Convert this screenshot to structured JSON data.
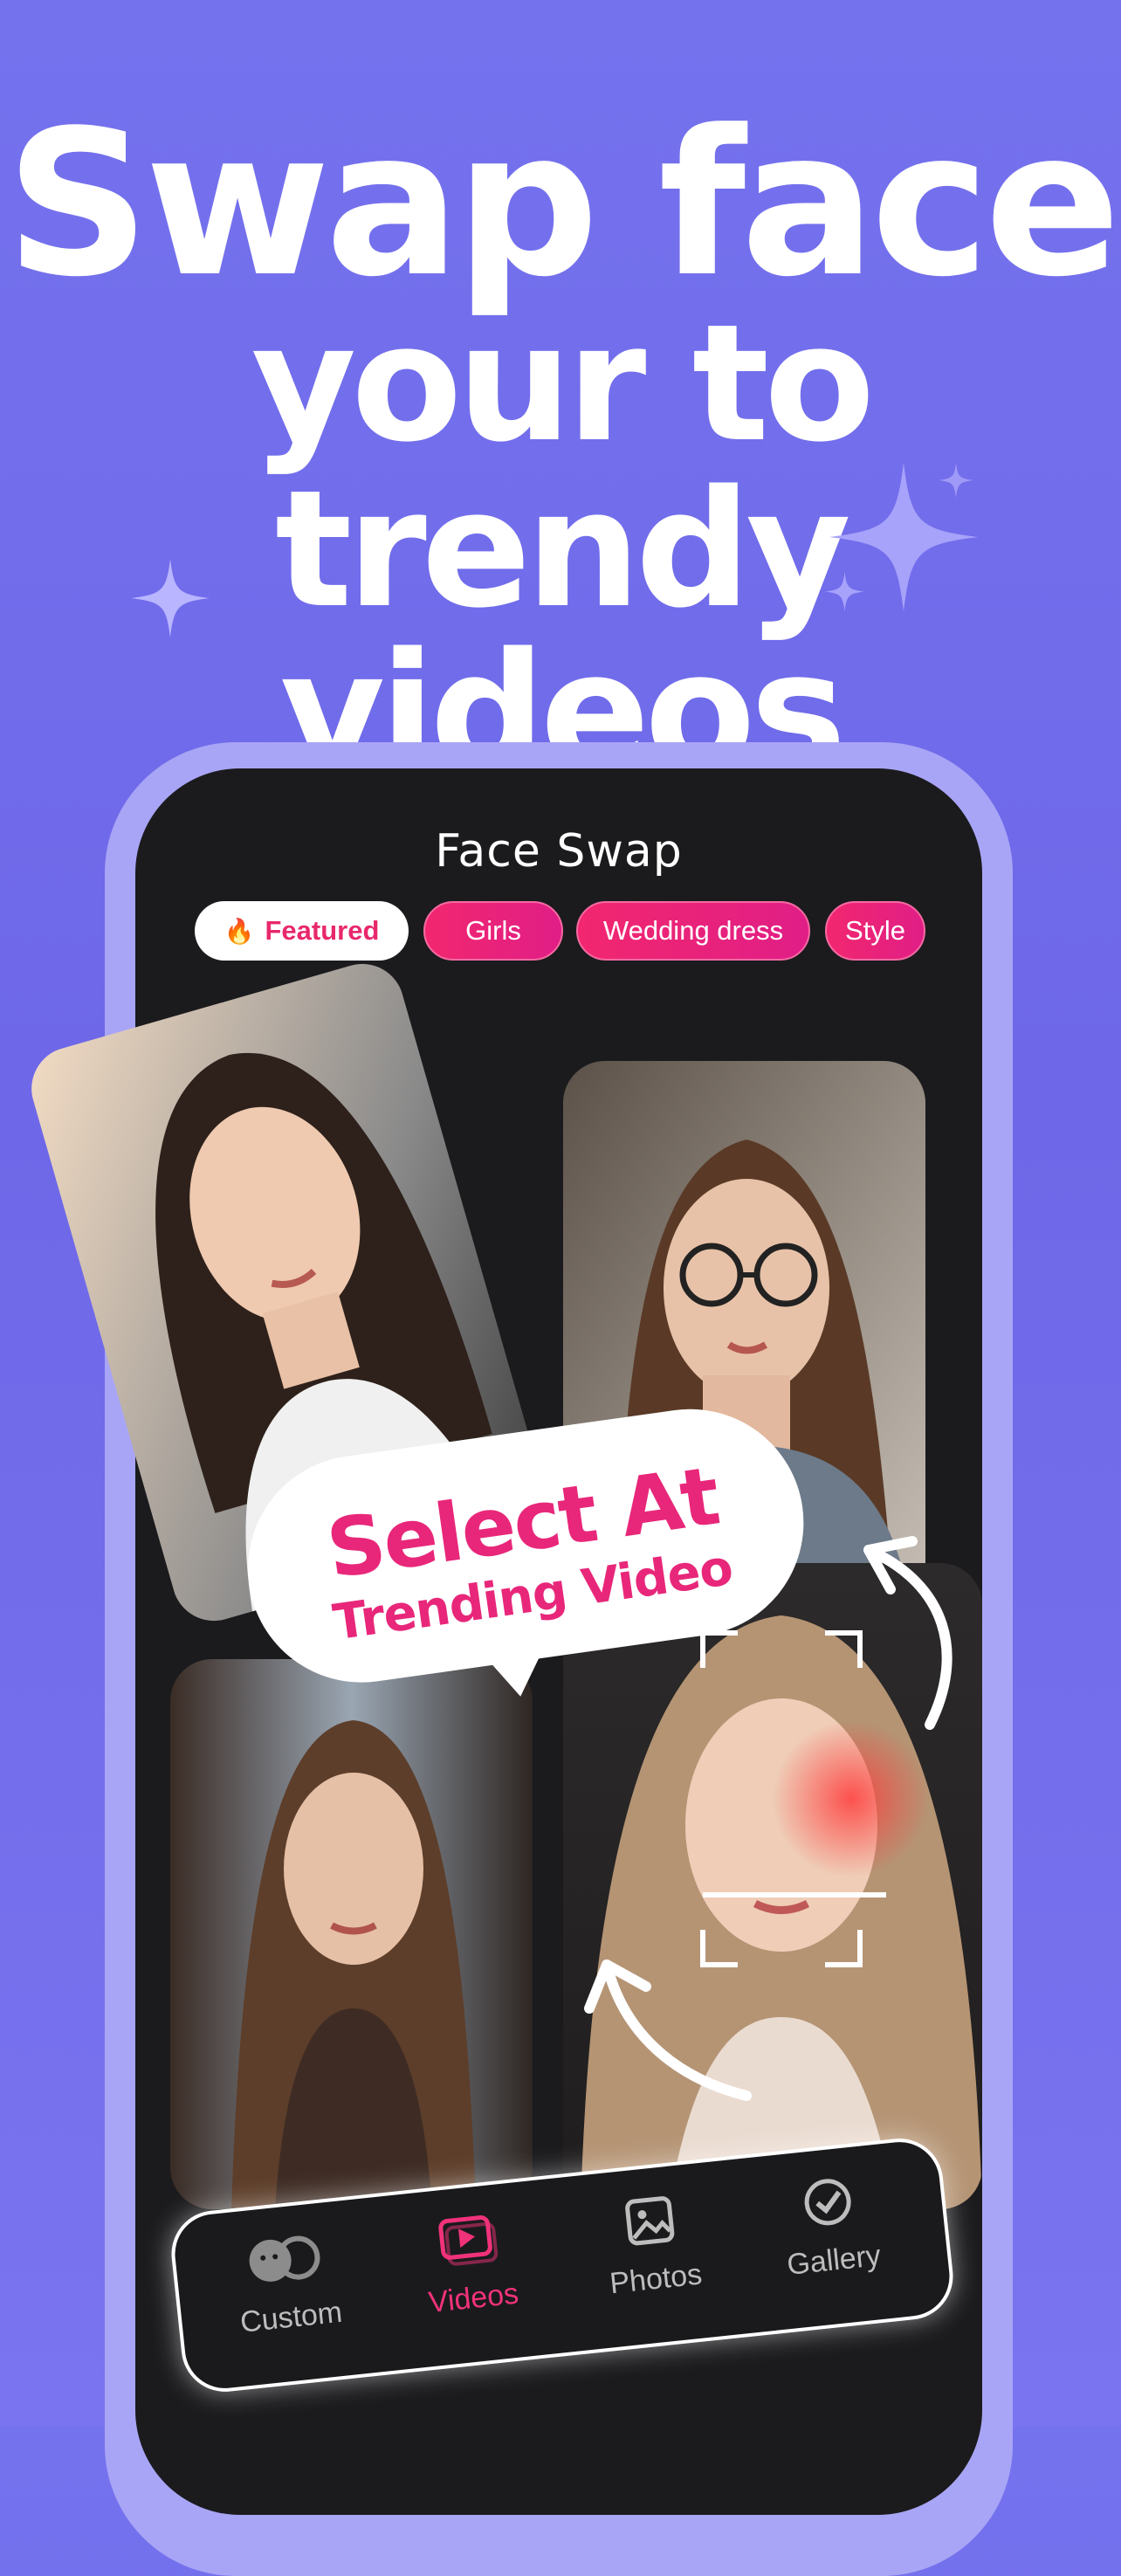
{
  "headline": {
    "line1": "Swap face",
    "line2": "your to trendy",
    "line3": "videos"
  },
  "screen": {
    "title": "Face Swap",
    "chips": [
      {
        "label": "Featured",
        "icon": "fire-icon",
        "active": true
      },
      {
        "label": "Girls",
        "active": false
      },
      {
        "label": "Wedding dress",
        "active": false
      },
      {
        "label": "Style",
        "active": false
      }
    ]
  },
  "bubble": {
    "line1": "Select At",
    "line2": "Trending Video"
  },
  "nav": {
    "items": [
      {
        "label": "Custom",
        "icon": "face-swap-icon",
        "active": false
      },
      {
        "label": "Videos",
        "icon": "video-play-icon",
        "active": true
      },
      {
        "label": "Photos",
        "icon": "photo-icon",
        "active": false
      },
      {
        "label": "Gallery",
        "icon": "check-circle-icon",
        "active": false
      }
    ]
  },
  "colors": {
    "background": "#7572EE",
    "accent": "#E8286C",
    "screen": "#1B1B1E"
  }
}
